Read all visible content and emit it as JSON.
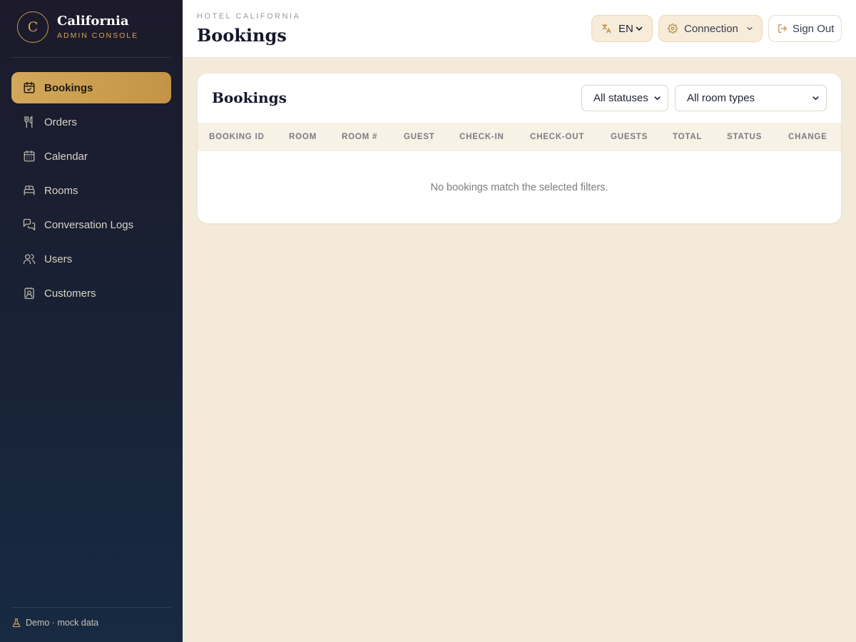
{
  "brand": {
    "logo_letter": "C",
    "title": "California",
    "subtitle": "ADMIN CONSOLE"
  },
  "sidebar": {
    "items": [
      {
        "label": "Bookings",
        "icon": "calendar-check-icon",
        "active": true
      },
      {
        "label": "Orders",
        "icon": "fork-knife-icon",
        "active": false
      },
      {
        "label": "Calendar",
        "icon": "calendar-icon",
        "active": false
      },
      {
        "label": "Rooms",
        "icon": "bed-icon",
        "active": false
      },
      {
        "label": "Conversation Logs",
        "icon": "chat-bubbles-icon",
        "active": false
      },
      {
        "label": "Users",
        "icon": "users-icon",
        "active": false
      },
      {
        "label": "Customers",
        "icon": "contact-badge-icon",
        "active": false
      }
    ],
    "footer": "Demo · mock data"
  },
  "header": {
    "eyebrow": "HOTEL CALIFORNIA",
    "title": "Bookings",
    "language": "EN",
    "connection": "Connection",
    "sign_out": "Sign Out"
  },
  "bookings": {
    "title": "Bookings",
    "status_filter": {
      "selected": "All statuses"
    },
    "room_type_filter": {
      "selected": "All room types"
    },
    "columns": [
      "BOOKING ID",
      "ROOM",
      "ROOM #",
      "GUEST",
      "CHECK-IN",
      "CHECK-OUT",
      "GUESTS",
      "TOTAL",
      "STATUS",
      "CHANGE"
    ],
    "rows": [],
    "empty_message": "No bookings match the selected filters."
  },
  "colors": {
    "accent_gold": "#c9a050",
    "sidebar_bg": "#1c1a2b",
    "page_bg": "#f3eada"
  }
}
